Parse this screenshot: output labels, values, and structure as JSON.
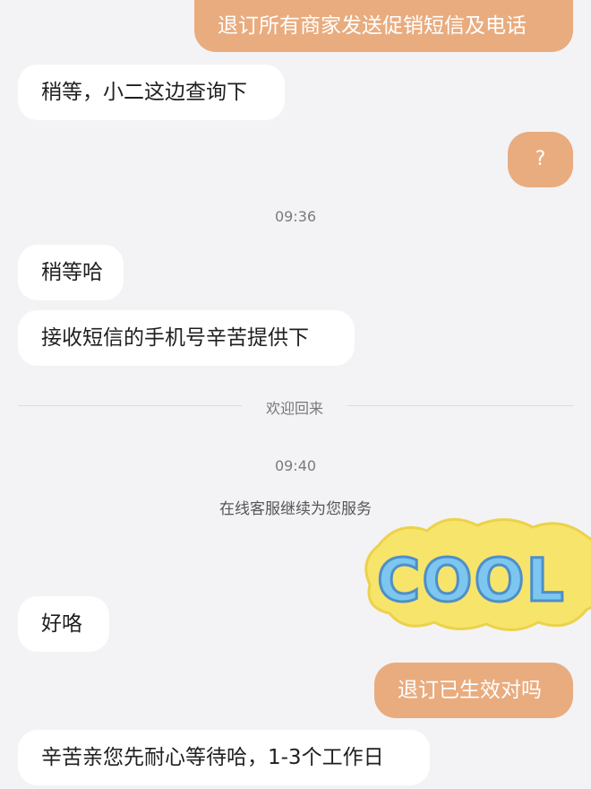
{
  "messages": {
    "m1": "退订所有商家发送促销短信及电话",
    "m2": "稍等，小二这边查询下",
    "m3": "?",
    "ts1": "09:36",
    "m4": "稍等哈",
    "m5": "接收短信的手机号辛苦提供下",
    "divider": "欢迎回来",
    "ts2": "09:40",
    "sys1": "在线客服继续为您服务",
    "sticker_text": "COOL",
    "m6": "好咯",
    "m7": "退订已生效对吗",
    "m8": "辛苦亲您先耐心等待哈，1-3个工作日"
  },
  "colors": {
    "outgoing_bubble": "#e9ac7f",
    "incoming_bubble": "#ffffff",
    "background": "#f3f3f5"
  }
}
